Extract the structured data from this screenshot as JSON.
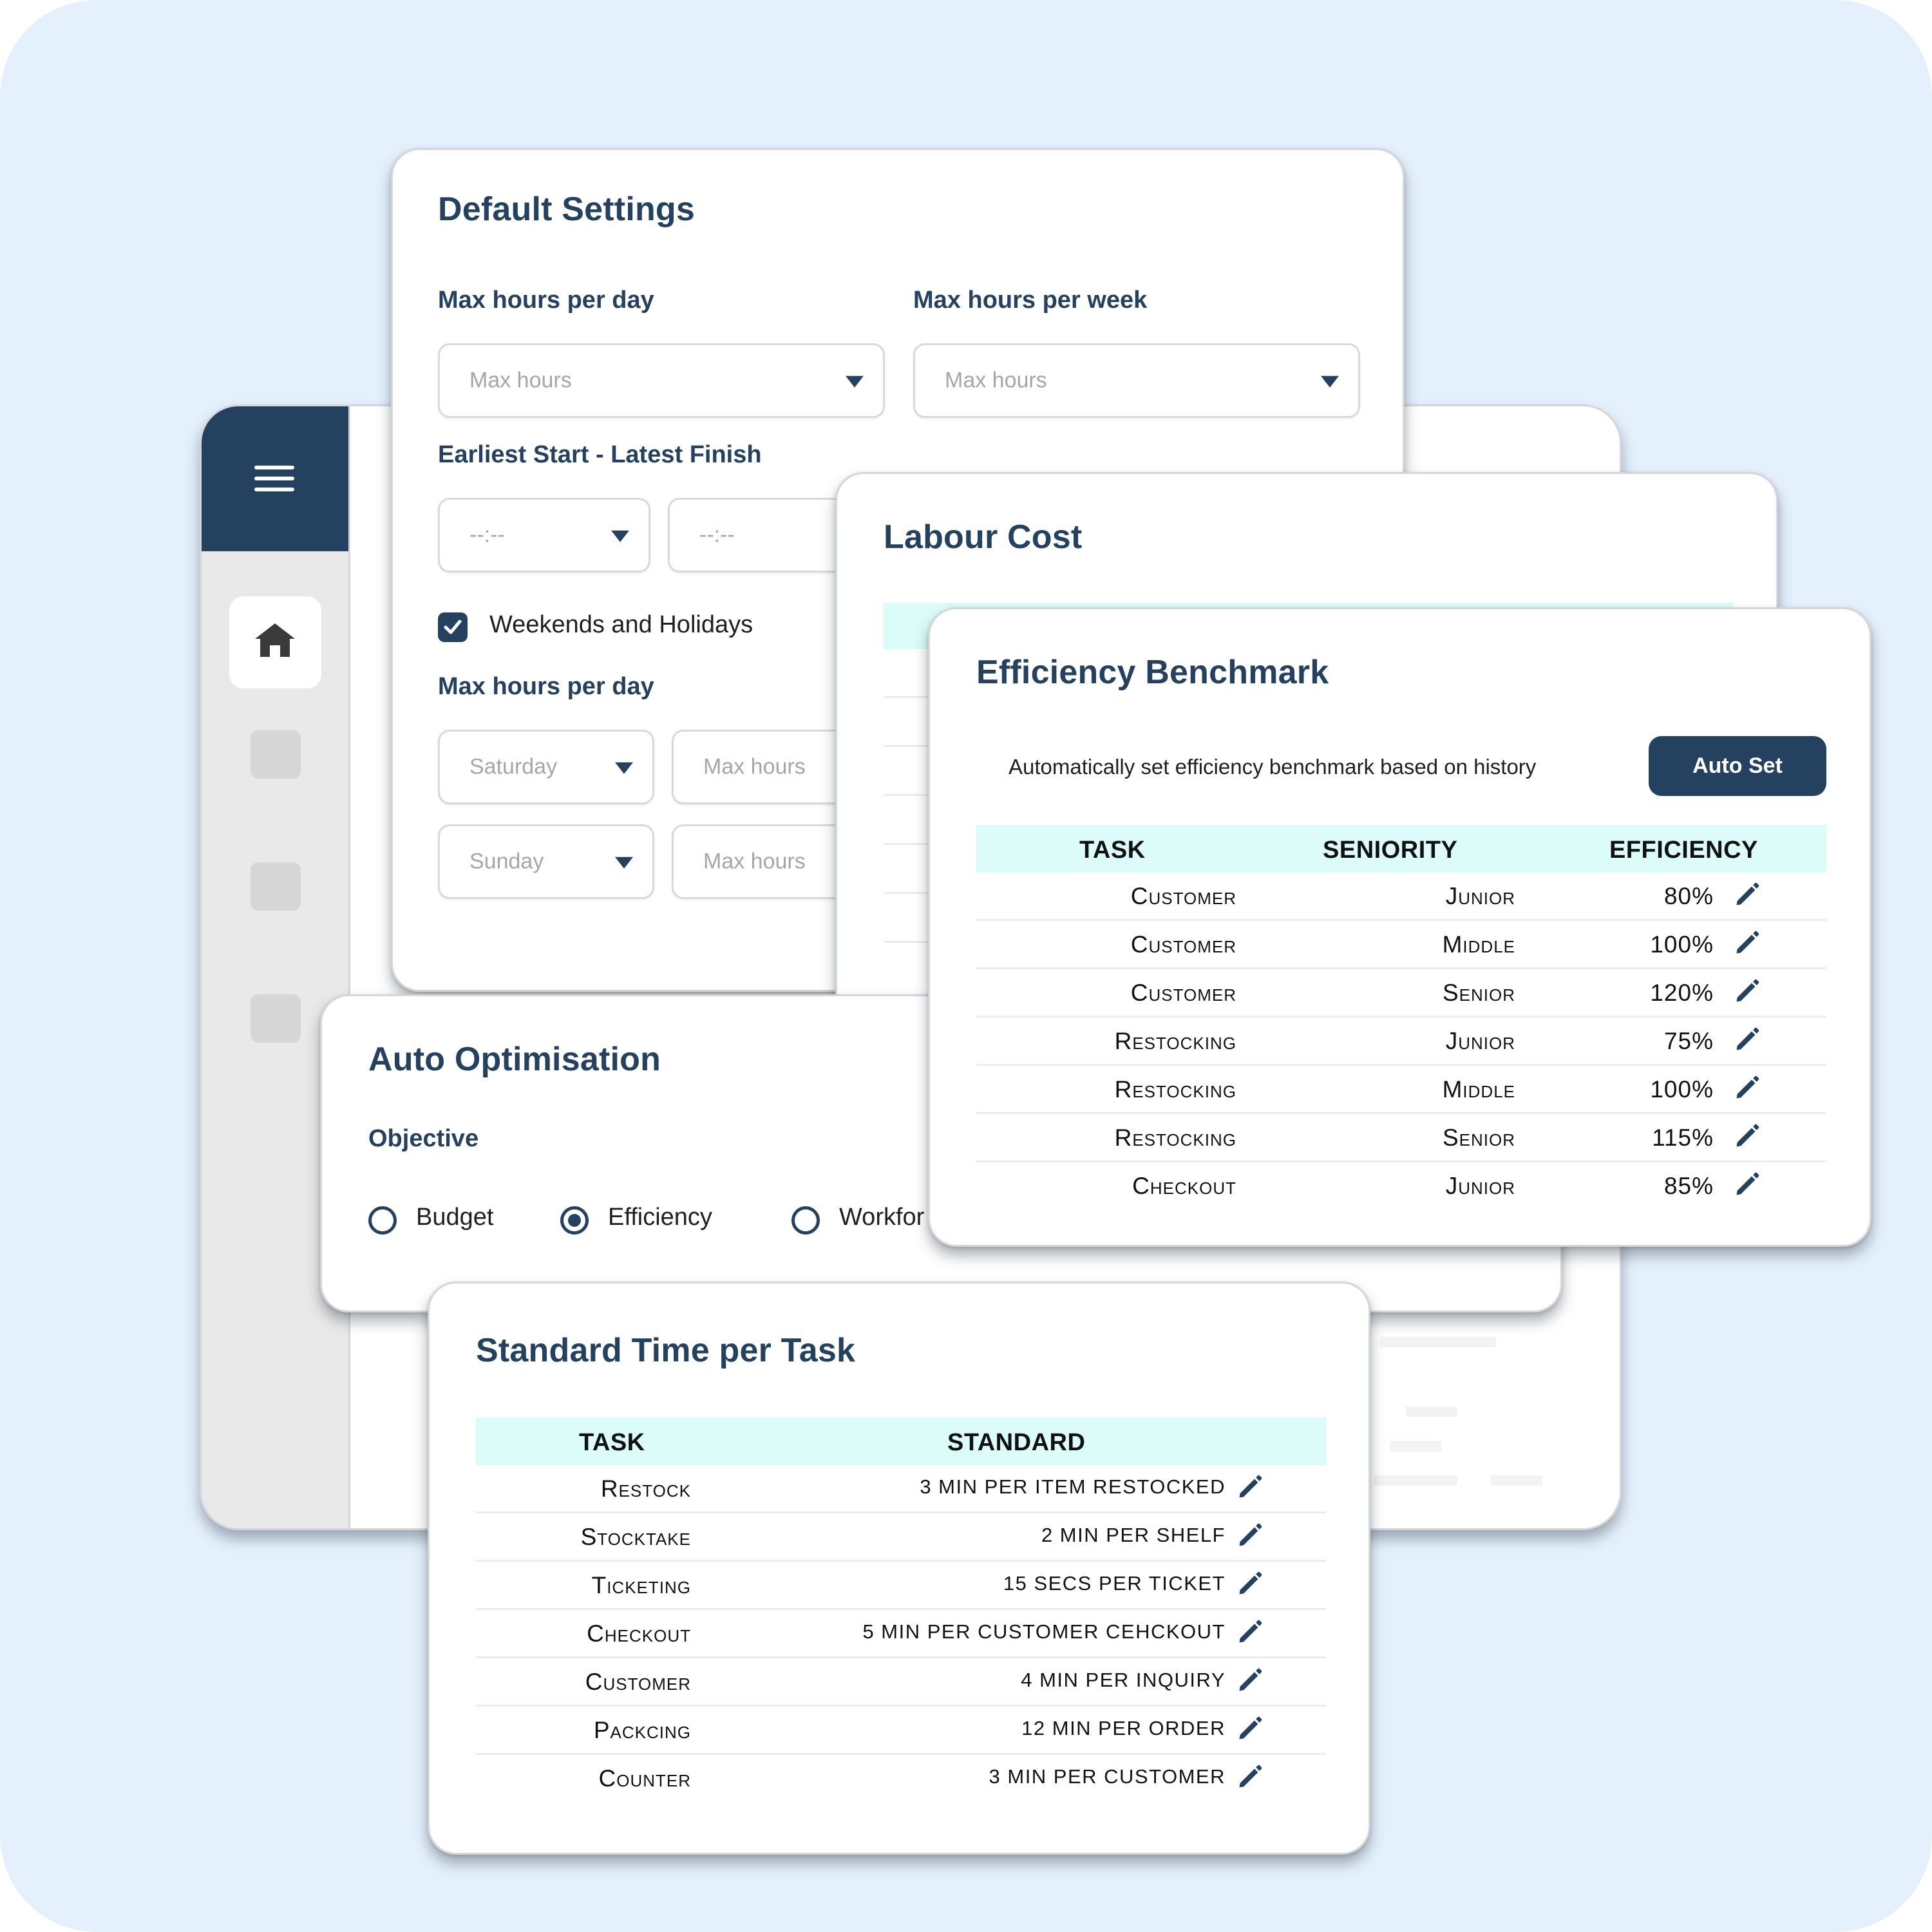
{
  "colors": {
    "primary": "#24425f",
    "page_background": "#e4f1fd",
    "table_header_background": "#dcfcf9",
    "placeholder_text": "#a6a6a6"
  },
  "sidebar": {
    "menu_icon": "hamburger-icon",
    "items": [
      {
        "icon": "home-icon",
        "active": true
      },
      {
        "icon": "placeholder",
        "active": false
      },
      {
        "icon": "placeholder",
        "active": false
      },
      {
        "icon": "placeholder",
        "active": false
      }
    ]
  },
  "default_settings": {
    "title": "Default Settings",
    "max_hours_per_day": {
      "label": "Max hours per day",
      "placeholder": "Max hours"
    },
    "max_hours_per_week": {
      "label": "Max hours per week",
      "placeholder": "Max hours"
    },
    "start_finish": {
      "label": "Earliest Start - Latest Finish",
      "start_placeholder": "--:--",
      "finish_placeholder": "--:--"
    },
    "weekends_holidays": {
      "label": "Weekends and Holidays",
      "checked": true
    },
    "weekend_max_hours": {
      "label": "Max hours per day",
      "rows": [
        {
          "day": "Saturday",
          "hours_placeholder": "Max hours"
        },
        {
          "day": "Sunday",
          "hours_placeholder": "Max hours"
        }
      ]
    }
  },
  "labour_cost": {
    "title": "Labour Cost"
  },
  "efficiency_benchmark": {
    "title": "Efficiency Benchmark",
    "description": "Automatically set efficiency benchmark based on history",
    "auto_set_label": "Auto Set",
    "columns": [
      "TASK",
      "SENIORITY",
      "EFFICIENCY"
    ],
    "rows": [
      {
        "task": "Customer",
        "seniority": "Junior",
        "efficiency": "80%"
      },
      {
        "task": "Customer",
        "seniority": "Middle",
        "efficiency": "100%"
      },
      {
        "task": "Customer",
        "seniority": "Senior",
        "efficiency": "120%"
      },
      {
        "task": "Restocking",
        "seniority": "Junior",
        "efficiency": "75%"
      },
      {
        "task": "Restocking",
        "seniority": "Middle",
        "efficiency": "100%"
      },
      {
        "task": "Restocking",
        "seniority": "Senior",
        "efficiency": "115%"
      },
      {
        "task": "Checkout",
        "seniority": "Junior",
        "efficiency": "85%"
      }
    ]
  },
  "auto_optimisation": {
    "title": "Auto Optimisation",
    "objective_label": "Objective",
    "options": [
      {
        "label": "Budget",
        "selected": false
      },
      {
        "label": "Efficiency",
        "selected": true
      },
      {
        "label": "Workfor",
        "selected": false
      }
    ]
  },
  "standard_time": {
    "title": "Standard Time per Task",
    "columns": [
      "TASK",
      "STANDARD"
    ],
    "rows": [
      {
        "task": "Restock",
        "standard": "3 min per item restocked"
      },
      {
        "task": "Stocktake",
        "standard": "2 min per shelf"
      },
      {
        "task": "Ticketing",
        "standard": "15 secs per ticket"
      },
      {
        "task": "Checkout",
        "standard": "5 min per customer cehckout"
      },
      {
        "task": "Customer",
        "standard": "4 min per inquiry"
      },
      {
        "task": "Packcing",
        "standard": "12 min per order"
      },
      {
        "task": "Counter",
        "standard": "3 min per customer"
      }
    ]
  }
}
